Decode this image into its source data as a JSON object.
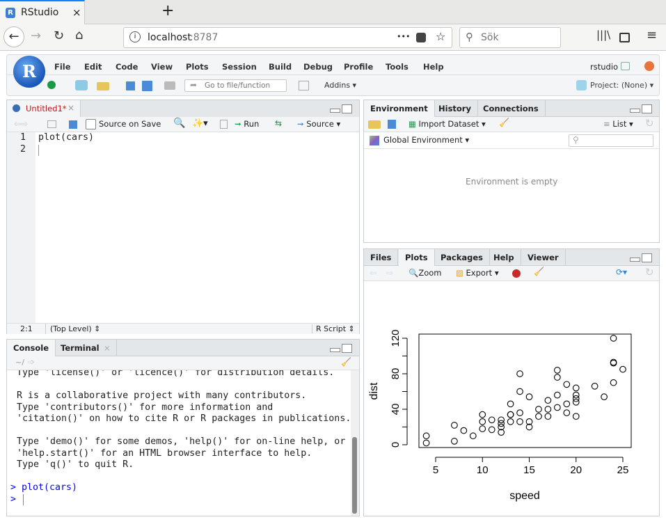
{
  "browser": {
    "tab_title": "RStudio",
    "tab_close": "×",
    "new_tab": "+",
    "url_host": "localhost",
    "url_port": ":8787",
    "search_placeholder": "Sök",
    "more": "•••"
  },
  "menu": [
    "File",
    "Edit",
    "Code",
    "View",
    "Plots",
    "Session",
    "Build",
    "Debug",
    "Profile",
    "Tools",
    "Help"
  ],
  "user": "rstudio",
  "toolbar": {
    "goto_placeholder": "Go to file/function",
    "addins": "Addins",
    "project": "Project: (None)"
  },
  "source": {
    "tab": "Untitled1*",
    "source_on_save": "Source on Save",
    "run": "Run",
    "source": "Source",
    "lines": [
      "plot(cars)",
      ""
    ],
    "line_numbers": [
      "1",
      "2"
    ],
    "position": "2:1",
    "scope": "(Top Level)",
    "filetype": "R Script"
  },
  "console": {
    "tabs": [
      "Console",
      "Terminal"
    ],
    "path": "~/",
    "lines": [
      "Type 'license()' or 'licence()' for distribution details.",
      "",
      "R is a collaborative project with many contributors.",
      "Type 'contributors()' for more information and",
      "'citation()' on how to cite R or R packages in publications.",
      "",
      "Type 'demo()' for some demos, 'help()' for on-line help, or",
      "'help.start()' for an HTML browser interface to help.",
      "Type 'q()' to quit R.",
      ""
    ],
    "commands": [
      "> plot(cars)",
      "> "
    ],
    "prompt_color": "#0000ff"
  },
  "environment": {
    "tabs": [
      "Environment",
      "History",
      "Connections"
    ],
    "import": "Import Dataset",
    "list": "List",
    "scope": "Global Environment",
    "empty": "Environment is empty"
  },
  "files": {
    "tabs": [
      "Files",
      "Plots",
      "Packages",
      "Help",
      "Viewer"
    ],
    "zoom": "Zoom",
    "export": "Export"
  },
  "chart_data": {
    "type": "scatter",
    "xlabel": "speed",
    "ylabel": "dist",
    "xlim": [
      4,
      25
    ],
    "ylim": [
      0,
      120
    ],
    "xticks": [
      5,
      10,
      15,
      20,
      25
    ],
    "yticks": [
      0,
      20,
      40,
      60,
      80,
      100,
      120
    ],
    "ytick_labels": [
      "0",
      "",
      "40",
      "",
      "80",
      "",
      "120"
    ],
    "grid": false,
    "x": [
      4,
      4,
      7,
      7,
      8,
      9,
      10,
      10,
      10,
      11,
      11,
      12,
      12,
      12,
      12,
      13,
      13,
      13,
      13,
      14,
      14,
      14,
      14,
      15,
      15,
      15,
      16,
      16,
      17,
      17,
      17,
      18,
      18,
      18,
      18,
      19,
      19,
      19,
      20,
      20,
      20,
      20,
      20,
      22,
      23,
      24,
      24,
      24,
      24,
      25
    ],
    "y": [
      2,
      10,
      4,
      22,
      16,
      10,
      18,
      26,
      34,
      17,
      28,
      14,
      20,
      24,
      28,
      26,
      34,
      34,
      46,
      26,
      36,
      60,
      80,
      20,
      26,
      54,
      32,
      40,
      32,
      40,
      50,
      42,
      56,
      76,
      84,
      36,
      46,
      68,
      32,
      48,
      52,
      56,
      64,
      66,
      54,
      70,
      92,
      93,
      120,
      85
    ]
  }
}
